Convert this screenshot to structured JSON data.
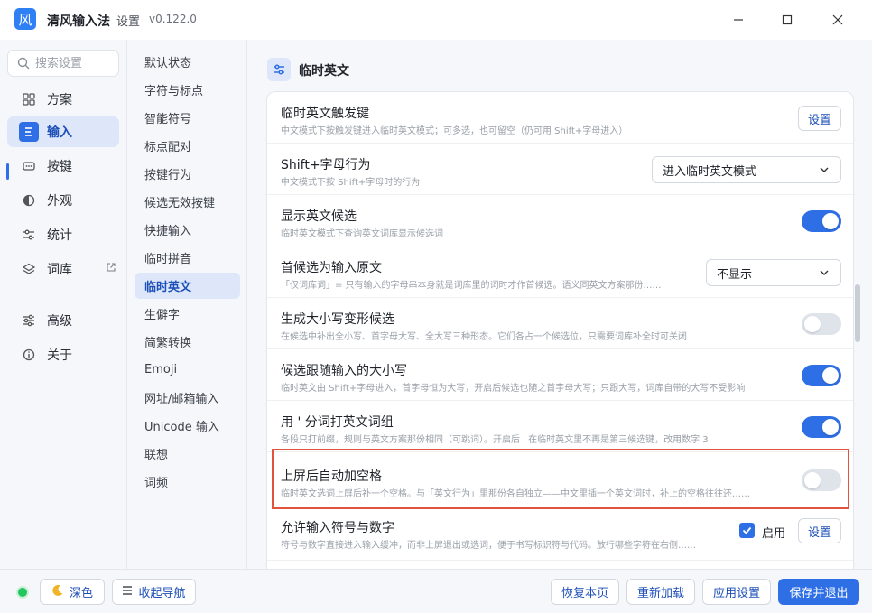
{
  "titlebar": {
    "logo": "风",
    "app_name": "清风输入法",
    "dot": "·",
    "section": "设置",
    "version": "v0.122.0"
  },
  "sidebar": {
    "search_placeholder": "搜索设置",
    "items": [
      {
        "label": "方案",
        "icon": "grid-icon"
      },
      {
        "label": "输入",
        "icon": "menu-lines-icon"
      },
      {
        "label": "按键",
        "icon": "keyboard-icon"
      },
      {
        "label": "外观",
        "icon": "contrast-icon"
      },
      {
        "label": "统计",
        "icon": "sliders-icon"
      },
      {
        "label": "词库",
        "icon": "layers-icon"
      },
      {
        "label": "高级",
        "icon": "settings-sliders-icon"
      },
      {
        "label": "关于",
        "icon": "info-icon"
      }
    ]
  },
  "subnav": {
    "items": [
      "默认状态",
      "字符与标点",
      "智能符号",
      "标点配对",
      "按键行为",
      "候选无效按键",
      "快捷输入",
      "临时拼音",
      "临时英文",
      "生僻字",
      "简繁转换",
      "Emoji",
      "网址/邮箱输入",
      "Unicode 输入",
      "联想",
      "词频"
    ]
  },
  "main": {
    "section_title": "临时英文",
    "rows": [
      {
        "title": "临时英文触发键",
        "desc": "中文模式下按触发键进入临时英文模式；可多选，也可留空（仍可用 Shift+字母进入）",
        "control": "button",
        "button_label": "设置"
      },
      {
        "title": "Shift+字母行为",
        "desc": "中文模式下按 Shift+字母时的行为",
        "control": "select",
        "select_value": "进入临时英文模式"
      },
      {
        "title": "显示英文候选",
        "desc": "临时英文模式下查询英文词库显示候选词",
        "control": "toggle",
        "on": true
      },
      {
        "title": "首候选为输入原文",
        "desc": "「仅词库词」= 只有输入的字母串本身就是词库里的词时才作首候选。语义同英文方案那份……",
        "control": "select",
        "select_value": "不显示"
      },
      {
        "title": "生成大小写变形候选",
        "desc": "在候选中补出全小写、首字母大写、全大写三种形态。它们各占一个候选位，只需要词库补全时可关闭",
        "control": "toggle",
        "on": false
      },
      {
        "title": "候选跟随输入的大小写",
        "desc": "临时英文由 Shift+字母进入，首字母恒为大写，开启后候选也随之首字母大写；只跟大写，词库自带的大写不受影响",
        "control": "toggle",
        "on": true
      },
      {
        "title": "用 ' 分词打英文词组",
        "desc": "各段只打前缀，规则与英文方案那份相同（可跳词）。开启后 ' 在临时英文里不再是第三候选键，改用数字 3",
        "control": "toggle",
        "on": true
      },
      {
        "title": "上屏后自动加空格",
        "desc": "临时英文选词上屏后补一个空格。与「英文行为」里那份各自独立——中文里插一个英文词时，补上的空格往往还……",
        "control": "toggle",
        "on": false
      },
      {
        "title": "允许输入符号与数字",
        "desc": "符号与数字直接进入输入缓冲，而非上屏退出或选词，便于书写标识符与代码。放行哪些字符在右侧……",
        "control": "checkbox-button",
        "checkbox_label": "启用",
        "button_label": "设置"
      }
    ]
  },
  "bottombar": {
    "theme_label": "深色",
    "collapse_label": "收起导航",
    "restore_label": "恢复本页",
    "reload_label": "重新加载",
    "apply_label": "应用设置",
    "save_label": "保存并退出"
  },
  "colors": {
    "accent": "#2f6fe6",
    "highlight_border": "#e0533d",
    "status_dot": "#22c55e"
  }
}
